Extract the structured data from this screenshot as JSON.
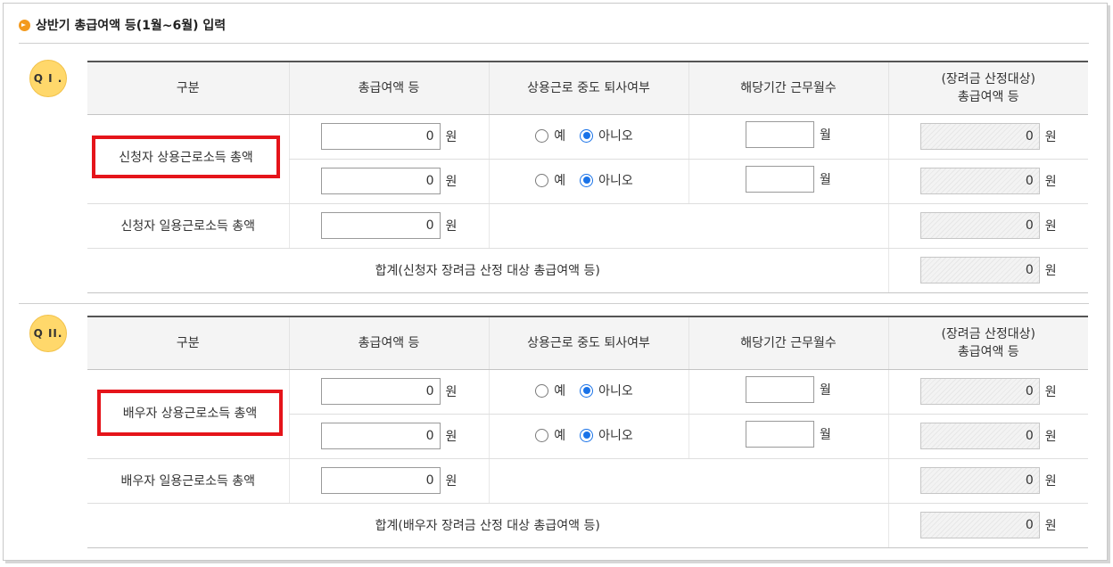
{
  "page": {
    "title": "상반기 총급여액 등(1월~6월) 입력"
  },
  "headers": {
    "col1": "구분",
    "col2": "총급여액 등",
    "col3": "상용근로 중도 퇴사여부",
    "col4": "해당기간 근무월수",
    "col5_line1": "(장려금 산정대상)",
    "col5_line2": "총급여액 등"
  },
  "common": {
    "won": "원",
    "month": "월",
    "yes": "예",
    "no": "아니오"
  },
  "section1": {
    "badge": "Q I .",
    "regular_label": "신청자 상용근로소득 총액",
    "daily_label": "신청자 일용근로소득 총액",
    "total_label": "합계(신청자 장려금 산정 대상 총급여액 등)",
    "rows": [
      {
        "amount": "0",
        "selected": "아니오",
        "months": "",
        "calc": "0"
      },
      {
        "amount": "0",
        "selected": "아니오",
        "months": "",
        "calc": "0"
      }
    ],
    "daily_amount": "0",
    "daily_calc": "0",
    "total_calc": "0"
  },
  "section2": {
    "badge": "Q II.",
    "regular_label": "배우자 상용근로소득 총액",
    "daily_label": "배우자 일용근로소득 총액",
    "total_label": "합계(배우자 장려금 산정 대상 총급여액 등)",
    "rows": [
      {
        "amount": "0",
        "selected": "아니오",
        "months": "",
        "calc": "0"
      },
      {
        "amount": "0",
        "selected": "아니오",
        "months": "",
        "calc": "0"
      }
    ],
    "daily_amount": "0",
    "daily_calc": "0",
    "total_calc": "0"
  },
  "colors": {
    "highlight_border": "#e5141a",
    "badge": "#ffd86b",
    "radio_selected": "#1a73e8",
    "title_bullet": "#f39a1e"
  }
}
